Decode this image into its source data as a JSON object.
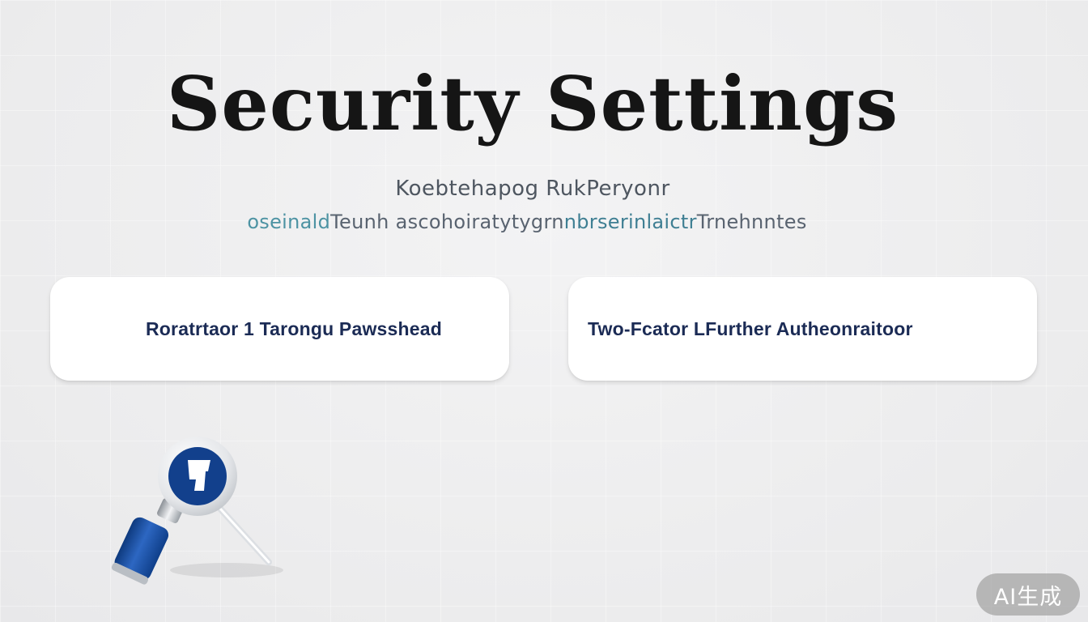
{
  "header": {
    "title": "Security Settings",
    "subtitle_line1": "Koebtehapog RukPeryonr",
    "subtitle_line2_parts": [
      "oseinald",
      "Teunh ascohoiratytygrn",
      "nbrserinlaictr",
      "Trnehnntes"
    ]
  },
  "options": [
    {
      "label": "Roratrtaor 1 Tarongu Pawsshead"
    },
    {
      "label": "Two-Fcator LFurther Autheonraitoor"
    }
  ],
  "watermark": {
    "text": "AI生成"
  },
  "colors": {
    "title": "#151515",
    "card_text": "#1b2b55",
    "accent_teal": "#4d93a3",
    "icon_blue": "#12408c"
  },
  "icons": {
    "illustration": "magnifier-icon"
  }
}
